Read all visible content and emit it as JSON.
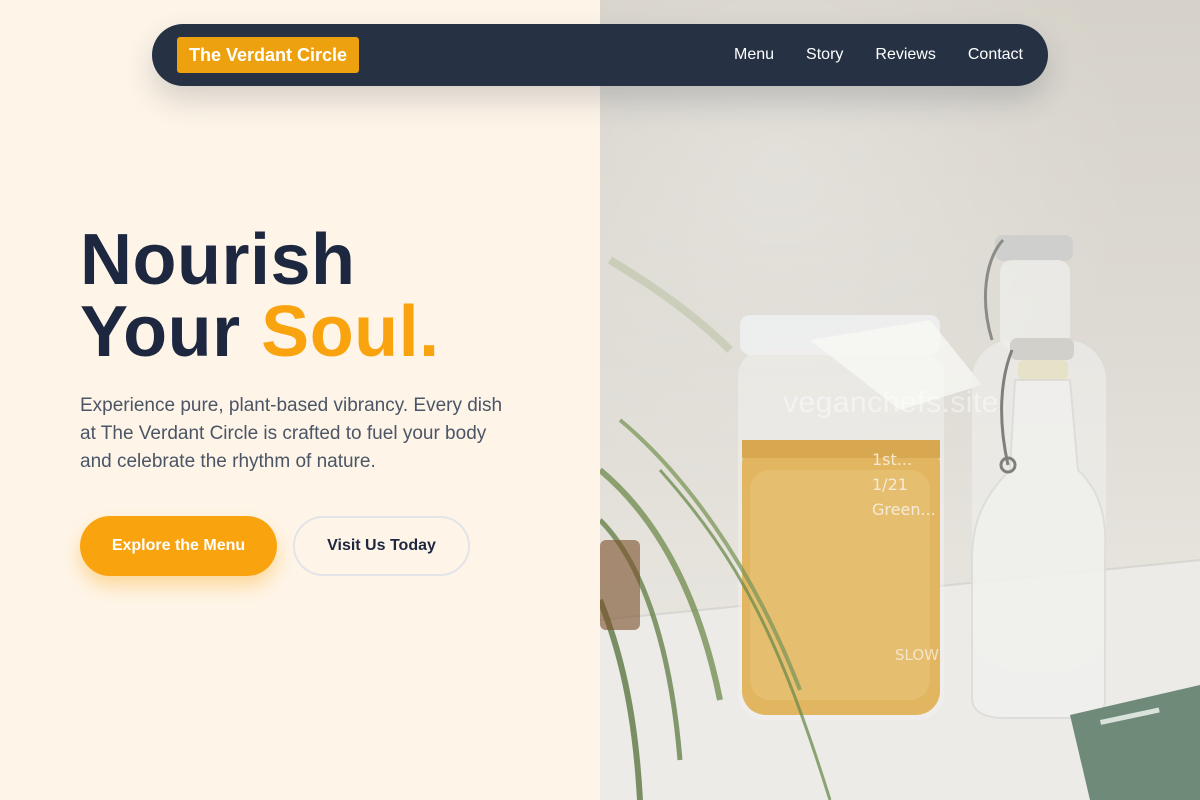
{
  "brand": {
    "name": "The Verdant Circle"
  },
  "nav": {
    "links": [
      {
        "label": "Menu"
      },
      {
        "label": "Story"
      },
      {
        "label": "Reviews"
      },
      {
        "label": "Contact"
      }
    ]
  },
  "hero": {
    "headline_line1": "Nourish",
    "headline_line2_prefix": "Your ",
    "headline_line2_accent": "Soul.",
    "subtext": "Experience pure, plant-based vibrancy. Every dish at The Verdant Circle is crafted to fuel your body and celebrate the rhythm of nature.",
    "primary_button": "Explore the Menu",
    "secondary_button": "Visit Us Today"
  },
  "photo": {
    "watermark": "veganchefs.site"
  },
  "colors": {
    "nav_bg": "#263244",
    "accent": "#f9a40e",
    "brand_bg": "#eda10f",
    "headline": "#1d2840",
    "page_bg": "#fef5e8"
  }
}
